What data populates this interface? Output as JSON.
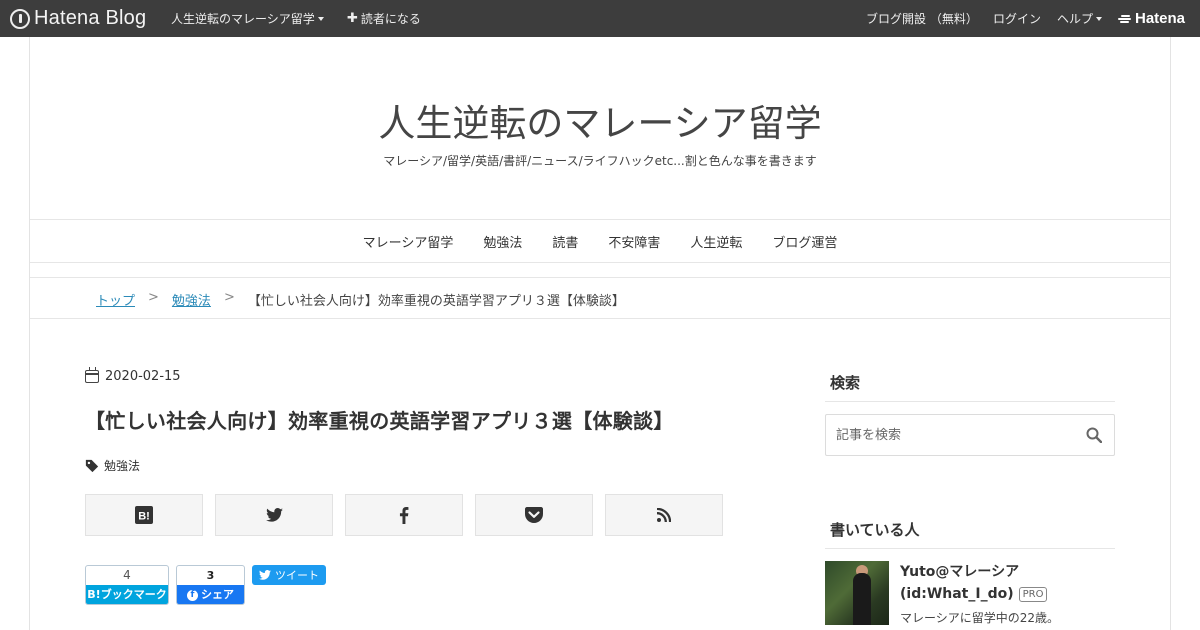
{
  "topbar": {
    "brand": "Hatena Blog",
    "blog_menu": "人生逆転のマレーシア留学",
    "subscribe": "読者になる",
    "start_blog": "ブログ開設 （無料）",
    "login": "ログイン",
    "help": "ヘルプ",
    "hatena": "Hatena"
  },
  "header": {
    "title": "人生逆転のマレーシア留学",
    "description": "マレーシア/留学/英語/書評/ニュース/ライフハックetc...割と色んな事を書きます"
  },
  "global_nav": [
    "マレーシア留学",
    "勉強法",
    "読書",
    "不安障害",
    "人生逆転",
    "ブログ運営"
  ],
  "breadcrumb": {
    "items": [
      "トップ",
      "勉強法",
      "【忙しい社会人向け】効率重視の英語学習アプリ３選【体験談】"
    ],
    "separator": ">"
  },
  "entry": {
    "date": "2020-02-15",
    "title": "【忙しい社会人向け】効率重視の英語学習アプリ３選【体験談】",
    "category": "勉強法"
  },
  "share_buttons": [
    "hatena-bookmark-icon",
    "twitter-icon",
    "facebook-icon",
    "pocket-icon",
    "rss-icon"
  ],
  "counters": {
    "hatena_count": "4",
    "hatena_label": "B!ブックマーク",
    "facebook_count": "3",
    "facebook_label": "シェア",
    "tweet_label": "ツイート"
  },
  "sidebar": {
    "search_heading": "検索",
    "search_placeholder": "記事を検索",
    "about_heading": "書いている人",
    "profile_name": "Yuto@マレーシア",
    "profile_id": "(id:What_I_do)",
    "pro_badge": "PRO",
    "profile_bio": "マレーシアに留学中の22歳。"
  },
  "colors": {
    "topbar_bg": "#3d3d3d",
    "link": "#2b8ab8",
    "hatena_blue": "#00a4de",
    "facebook_blue": "#1877f2",
    "twitter_blue": "#1d9bf0"
  }
}
